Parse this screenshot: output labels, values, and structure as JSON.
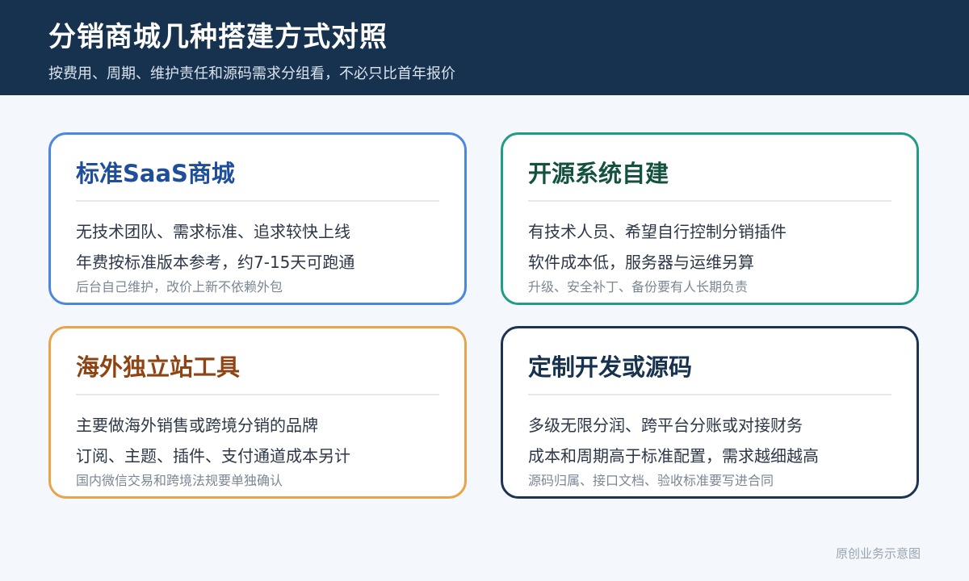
{
  "header": {
    "title": "分销商城几种搭建方式对照",
    "subtitle": "按费用、周期、维护责任和源码需求分组看，不必只比首年报价"
  },
  "cards": [
    {
      "title": "标准SaaS商城",
      "line1": "无技术团队、需求标准、追求较快上线",
      "line2": "年费按标准版本参考，约7-15天可跑通",
      "note": "后台自己维护，改价上新不依赖外包",
      "border_color": "#4a87e0",
      "title_color": "#1f4e9b"
    },
    {
      "title": "开源系统自建",
      "line1": "有技术人员、希望自行控制分销插件",
      "line2": "软件成本低，服务器与运维另算",
      "note": "升级、安全补丁、备份要有人长期负责",
      "border_color": "#1f9c85",
      "title_color": "#14523f"
    },
    {
      "title": "海外独立站工具",
      "line1": "主要做海外销售或跨境分销的品牌",
      "line2": "订阅、主题、插件、支付通道成本另计",
      "note": "国内微信交易和跨境法规要单独确认",
      "border_color": "#e8a449",
      "title_color": "#8f4414"
    },
    {
      "title": "定制开发或源码",
      "line1": "多级无限分润、跨平台分账或对接财务",
      "line2": "成本和周期高于标准配置，需求越细越高",
      "note": "源码归属、接口文档、验收标准要写进合同",
      "border_color": "#1c3352",
      "title_color": "#17324f"
    }
  ],
  "footer": {
    "note": "原创业务示意图"
  }
}
